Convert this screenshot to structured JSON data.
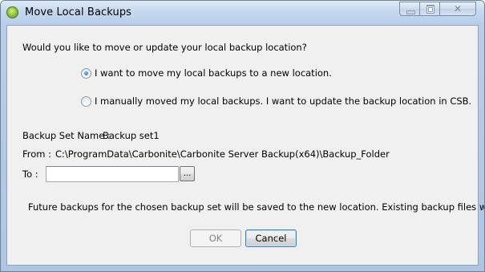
{
  "window": {
    "title": "Move Local Backups"
  },
  "dialog": {
    "question": "Would you like to move or update your local backup location?",
    "options": [
      {
        "label": "I want to move my local backups to a new location.",
        "selected": true
      },
      {
        "label": "I manually moved my local backups. I want to update the backup location in CSB.",
        "selected": false
      }
    ],
    "backup_set_label": "Backup Set Name :",
    "backup_set_value": "Backup set1",
    "from_label": "From :",
    "from_value": "C:\\ProgramData\\Carbonite\\Carbonite Server Backup(x64)\\Backup_Folder",
    "to_label": "To :",
    "to_value": "",
    "browse_label": "...",
    "note": "Future backups for the chosen backup set will be saved to the new location. Existing backup files will be moved."
  },
  "buttons": {
    "ok": "OK",
    "cancel": "Cancel"
  },
  "colors": {
    "frame": "#b8cde8",
    "client": "#f0f0f0",
    "focus_border": "#3c7fb1"
  }
}
